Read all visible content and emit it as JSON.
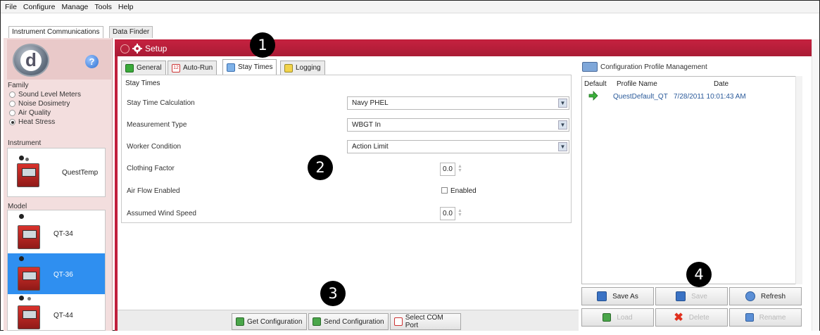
{
  "menu": [
    "File",
    "Configure",
    "Manage",
    "Tools",
    "Help"
  ],
  "top_tabs": [
    {
      "label": "Instrument Communications",
      "active": true
    },
    {
      "label": "Data Finder",
      "active": false
    }
  ],
  "left": {
    "family_title": "Family",
    "families": [
      {
        "label": "Sound Level Meters",
        "selected": false
      },
      {
        "label": "Noise Dosimetry",
        "selected": false
      },
      {
        "label": "Air Quality",
        "selected": false
      },
      {
        "label": "Heat Stress",
        "selected": true
      }
    ],
    "instrument_title": "Instrument",
    "instrument_name": "QuestTemp",
    "model_title": "Model",
    "models": [
      {
        "label": "QT-34",
        "selected": false
      },
      {
        "label": "QT-36",
        "selected": true
      },
      {
        "label": "QT-44",
        "selected": false
      }
    ]
  },
  "setup": {
    "title": "Setup",
    "tabs": [
      {
        "label": "General",
        "active": false
      },
      {
        "label": "Auto-Run",
        "active": false
      },
      {
        "label": "Stay Times",
        "active": true
      },
      {
        "label": "Logging",
        "active": false
      }
    ],
    "section_title": "Stay Times",
    "fields": {
      "stay_time_calc_label": "Stay Time Calculation",
      "stay_time_calc_value": "Navy PHEL",
      "measurement_type_label": "Measurement Type",
      "measurement_type_value": "WBGT In",
      "worker_condition_label": "Worker Condition",
      "worker_condition_value": "Action Limit",
      "clothing_factor_label": "Clothing Factor",
      "clothing_factor_value": "0.0",
      "air_flow_label": "Air Flow Enabled",
      "air_flow_checkbox_label": "Enabled",
      "air_flow_checked": false,
      "wind_speed_label": "Assumed Wind Speed",
      "wind_speed_value": "0.0"
    },
    "bottom_buttons": [
      "Get Configuration",
      "Send Configuration",
      "Select COM Port"
    ]
  },
  "profiles": {
    "title": "Configuration Profile Management",
    "columns": [
      "Default",
      "Profile Name",
      "Date"
    ],
    "rows": [
      {
        "name": "QuestDefault_QT",
        "date": "7/28/2011 10:01:43 AM",
        "default": true
      }
    ],
    "buttons": [
      {
        "label": "Save As",
        "enabled": true
      },
      {
        "label": "Save",
        "enabled": false
      },
      {
        "label": "Refresh",
        "enabled": true
      },
      {
        "label": "Load",
        "enabled": false
      },
      {
        "label": "Delete",
        "enabled": false
      },
      {
        "label": "Rename",
        "enabled": false
      }
    ]
  },
  "callouts": [
    "1",
    "2",
    "3",
    "4"
  ],
  "colors": {
    "accent": "#c01f3c",
    "selection": "#2f8ff0",
    "panel": "#f3dede"
  }
}
